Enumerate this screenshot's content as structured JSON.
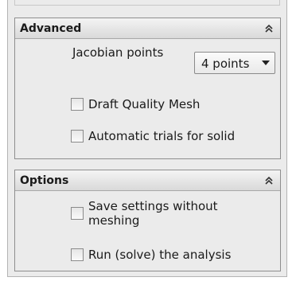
{
  "advanced": {
    "title": "Advanced",
    "jacobian_label": "Jacobian points",
    "jacobian_value": "4 points",
    "draft_quality_label": "Draft Quality Mesh",
    "automatic_trials_label": "Automatic trials for solid"
  },
  "options": {
    "title": "Options",
    "save_settings_label": "Save settings without meshing",
    "run_analysis_label": "Run (solve) the analysis"
  },
  "icons": {
    "collapse": "double-chevron-up-icon",
    "dropdown": "triangle-down-icon"
  }
}
